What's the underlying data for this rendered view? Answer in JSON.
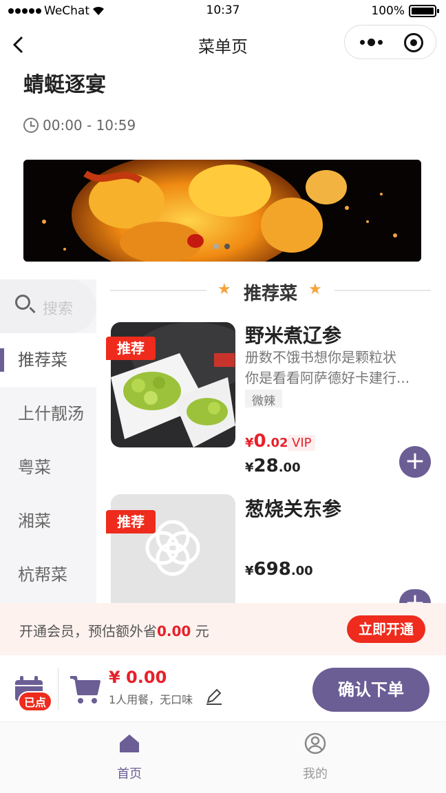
{
  "status_bar": {
    "carrier": "WeChat",
    "time": "10:37",
    "battery": "100%"
  },
  "nav": {
    "title": "菜单页"
  },
  "shop": {
    "name": "蜻蜓逐宴",
    "hours": "00:00 - 10:59"
  },
  "search": {
    "placeholder": "搜索"
  },
  "sidebar": {
    "items": [
      {
        "label": "推荐菜",
        "active": true
      },
      {
        "label": "上什靓汤",
        "active": false
      },
      {
        "label": "粤菜",
        "active": false
      },
      {
        "label": "湘菜",
        "active": false
      },
      {
        "label": "杭帮菜",
        "active": false
      }
    ]
  },
  "section": {
    "title": "推荐菜"
  },
  "dishes": [
    {
      "tag": "推荐",
      "name": "野米煮辽参",
      "desc_line1": "册数不饿书想你是颗粒状",
      "desc_line2": "你是看看阿萨德好卡建行...",
      "taste": "微辣",
      "vip_currency": "¥",
      "vip_int": "0",
      "vip_dec": ".02",
      "vip_label": "VIP",
      "currency": "¥",
      "price_int": "28",
      "price_dec": ".00"
    },
    {
      "tag": "推荐",
      "name": "葱烧关东参",
      "currency": "¥",
      "price_int": "698",
      "price_dec": ".00"
    }
  ],
  "member": {
    "text_before": "开通会员，预估额外省",
    "amount": "0.00",
    "text_after": " 元",
    "button": "立即开通"
  },
  "cart": {
    "ordered_badge": "已点",
    "total": "¥ 0.00",
    "diners": "1人用餐，无口味",
    "confirm": "确认下单"
  },
  "tabbar": {
    "home": "首页",
    "mine": "我的"
  },
  "colors": {
    "accent": "#6b5e95",
    "red": "#ee2b1c",
    "star": "#f5a33b"
  }
}
